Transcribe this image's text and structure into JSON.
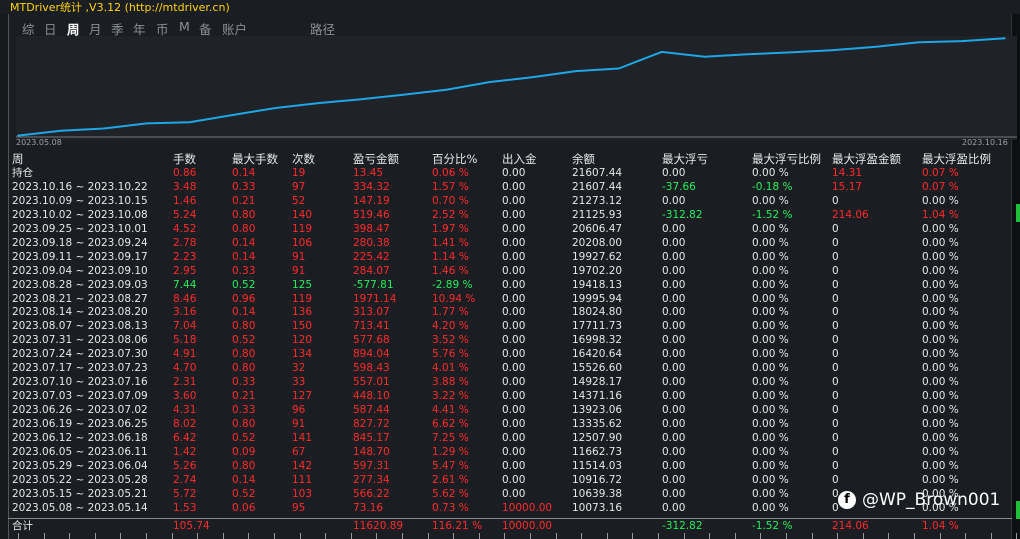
{
  "window": {
    "title": "MTDriver统计 ,V3.12 (http://mtdriver.cn)"
  },
  "tabs": [
    {
      "label": "综",
      "active": false
    },
    {
      "label": "日",
      "active": false
    },
    {
      "label": "周",
      "active": true
    },
    {
      "label": "月",
      "active": false
    },
    {
      "label": "季",
      "active": false
    },
    {
      "label": "年",
      "active": false
    },
    {
      "label": "币",
      "active": false
    },
    {
      "label": "M",
      "active": false
    },
    {
      "label": "备",
      "active": false
    },
    {
      "label": "账户",
      "active": false
    }
  ],
  "path_label": "路径",
  "chart_data": {
    "type": "line",
    "x_start_label": "2023.05.08",
    "x_end_label": "2023.10.16",
    "x": [
      "2023.05.08",
      "2023.05.15",
      "2023.05.22",
      "2023.05.29",
      "2023.06.05",
      "2023.06.12",
      "2023.06.19",
      "2023.06.26",
      "2023.07.03",
      "2023.07.10",
      "2023.07.17",
      "2023.07.24",
      "2023.07.31",
      "2023.08.07",
      "2023.08.14",
      "2023.08.21",
      "2023.08.28",
      "2023.09.04",
      "2023.09.11",
      "2023.09.18",
      "2023.09.25",
      "2023.10.02",
      "2023.10.09",
      "2023.10.16"
    ],
    "values": [
      10073.16,
      10639.38,
      10916.72,
      11514.03,
      11662.73,
      12507.9,
      13335.62,
      13923.06,
      14371.16,
      14928.17,
      15526.6,
      16420.64,
      16998.32,
      17711.73,
      18024.8,
      19995.94,
      19418.13,
      19702.2,
      19927.62,
      20208.0,
      20606.47,
      21125.93,
      21273.12,
      21607.44
    ],
    "line_color": "#1ea7e6"
  },
  "table": {
    "headers": [
      "周",
      "手数",
      "最大手数",
      "次数",
      "盈亏金额",
      "百分比%",
      "出入金",
      "余额",
      "最大浮亏",
      "最大浮亏比例",
      "最大浮盈金额",
      "最大浮盈比例"
    ],
    "rows": [
      {
        "cells": [
          "持仓",
          "0.86",
          "0.14",
          "19",
          "13.45",
          "0.06 %",
          "0.00",
          "21607.44",
          "0.00",
          "0.00 %",
          "14.31",
          "0.07 %"
        ],
        "colors": [
          "w",
          "r",
          "r",
          "r",
          "r",
          "r",
          "w",
          "w",
          "w",
          "w",
          "r",
          "r"
        ]
      },
      {
        "cells": [
          "2023.10.16 ~ 2023.10.22",
          "3.48",
          "0.33",
          "97",
          "334.32",
          "1.57 %",
          "0.00",
          "21607.44",
          "-37.66",
          "-0.18 %",
          "15.17",
          "0.07 %"
        ],
        "colors": [
          "w",
          "r",
          "r",
          "r",
          "r",
          "r",
          "w",
          "w",
          "g",
          "g",
          "r",
          "r"
        ]
      },
      {
        "cells": [
          "2023.10.09 ~ 2023.10.15",
          "1.46",
          "0.21",
          "52",
          "147.19",
          "0.70 %",
          "0.00",
          "21273.12",
          "0.00",
          "0.00 %",
          "0",
          "0.00 %"
        ],
        "colors": [
          "w",
          "r",
          "r",
          "r",
          "r",
          "r",
          "w",
          "w",
          "w",
          "w",
          "w",
          "w"
        ]
      },
      {
        "cells": [
          "2023.10.02 ~ 2023.10.08",
          "5.24",
          "0.80",
          "140",
          "519.46",
          "2.52 %",
          "0.00",
          "21125.93",
          "-312.82",
          "-1.52 %",
          "214.06",
          "1.04 %"
        ],
        "colors": [
          "w",
          "r",
          "r",
          "r",
          "r",
          "r",
          "w",
          "w",
          "g",
          "g",
          "r",
          "r"
        ]
      },
      {
        "cells": [
          "2023.09.25 ~ 2023.10.01",
          "4.52",
          "0.80",
          "119",
          "398.47",
          "1.97 %",
          "0.00",
          "20606.47",
          "0.00",
          "0.00 %",
          "0",
          "0.00 %"
        ],
        "colors": [
          "w",
          "r",
          "r",
          "r",
          "r",
          "r",
          "w",
          "w",
          "w",
          "w",
          "w",
          "w"
        ]
      },
      {
        "cells": [
          "2023.09.18 ~ 2023.09.24",
          "2.78",
          "0.14",
          "106",
          "280.38",
          "1.41 %",
          "0.00",
          "20208.00",
          "0.00",
          "0.00 %",
          "0",
          "0.00 %"
        ],
        "colors": [
          "w",
          "r",
          "r",
          "r",
          "r",
          "r",
          "w",
          "w",
          "w",
          "w",
          "w",
          "w"
        ]
      },
      {
        "cells": [
          "2023.09.11 ~ 2023.09.17",
          "2.23",
          "0.14",
          "91",
          "225.42",
          "1.14 %",
          "0.00",
          "19927.62",
          "0.00",
          "0.00 %",
          "0",
          "0.00 %"
        ],
        "colors": [
          "w",
          "r",
          "r",
          "r",
          "r",
          "r",
          "w",
          "w",
          "w",
          "w",
          "w",
          "w"
        ]
      },
      {
        "cells": [
          "2023.09.04 ~ 2023.09.10",
          "2.95",
          "0.33",
          "91",
          "284.07",
          "1.46 %",
          "0.00",
          "19702.20",
          "0.00",
          "0.00 %",
          "0",
          "0.00 %"
        ],
        "colors": [
          "w",
          "r",
          "r",
          "r",
          "r",
          "r",
          "w",
          "w",
          "w",
          "w",
          "w",
          "w"
        ]
      },
      {
        "cells": [
          "2023.08.28 ~ 2023.09.03",
          "7.44",
          "0.52",
          "125",
          "-577.81",
          "-2.89 %",
          "0.00",
          "19418.13",
          "0.00",
          "0.00 %",
          "0",
          "0.00 %"
        ],
        "colors": [
          "w",
          "g",
          "g",
          "g",
          "g",
          "g",
          "w",
          "w",
          "w",
          "w",
          "w",
          "w"
        ]
      },
      {
        "cells": [
          "2023.08.21 ~ 2023.08.27",
          "8.46",
          "0.96",
          "119",
          "1971.14",
          "10.94 %",
          "0.00",
          "19995.94",
          "0.00",
          "0.00 %",
          "0",
          "0.00 %"
        ],
        "colors": [
          "w",
          "r",
          "r",
          "r",
          "r",
          "r",
          "w",
          "w",
          "w",
          "w",
          "w",
          "w"
        ]
      },
      {
        "cells": [
          "2023.08.14 ~ 2023.08.20",
          "3.16",
          "0.14",
          "136",
          "313.07",
          "1.77 %",
          "0.00",
          "18024.80",
          "0.00",
          "0.00 %",
          "0",
          "0.00 %"
        ],
        "colors": [
          "w",
          "r",
          "r",
          "r",
          "r",
          "r",
          "w",
          "w",
          "w",
          "w",
          "w",
          "w"
        ]
      },
      {
        "cells": [
          "2023.08.07 ~ 2023.08.13",
          "7.04",
          "0.80",
          "150",
          "713.41",
          "4.20 %",
          "0.00",
          "17711.73",
          "0.00",
          "0.00 %",
          "0",
          "0.00 %"
        ],
        "colors": [
          "w",
          "r",
          "r",
          "r",
          "r",
          "r",
          "w",
          "w",
          "w",
          "w",
          "w",
          "w"
        ]
      },
      {
        "cells": [
          "2023.07.31 ~ 2023.08.06",
          "5.18",
          "0.52",
          "120",
          "577.68",
          "3.52 %",
          "0.00",
          "16998.32",
          "0.00",
          "0.00 %",
          "0",
          "0.00 %"
        ],
        "colors": [
          "w",
          "r",
          "r",
          "r",
          "r",
          "r",
          "w",
          "w",
          "w",
          "w",
          "w",
          "w"
        ]
      },
      {
        "cells": [
          "2023.07.24 ~ 2023.07.30",
          "4.91",
          "0.80",
          "134",
          "894.04",
          "5.76 %",
          "0.00",
          "16420.64",
          "0.00",
          "0.00 %",
          "0",
          "0.00 %"
        ],
        "colors": [
          "w",
          "r",
          "r",
          "r",
          "r",
          "r",
          "w",
          "w",
          "w",
          "w",
          "w",
          "w"
        ]
      },
      {
        "cells": [
          "2023.07.17 ~ 2023.07.23",
          "4.70",
          "0.80",
          "32",
          "598.43",
          "4.01 %",
          "0.00",
          "15526.60",
          "0.00",
          "0.00 %",
          "0",
          "0.00 %"
        ],
        "colors": [
          "w",
          "r",
          "r",
          "r",
          "r",
          "r",
          "w",
          "w",
          "w",
          "w",
          "w",
          "w"
        ]
      },
      {
        "cells": [
          "2023.07.10 ~ 2023.07.16",
          "2.31",
          "0.33",
          "33",
          "557.01",
          "3.88 %",
          "0.00",
          "14928.17",
          "0.00",
          "0.00 %",
          "0",
          "0.00 %"
        ],
        "colors": [
          "w",
          "r",
          "r",
          "r",
          "r",
          "r",
          "w",
          "w",
          "w",
          "w",
          "w",
          "w"
        ]
      },
      {
        "cells": [
          "2023.07.03 ~ 2023.07.09",
          "3.60",
          "0.21",
          "127",
          "448.10",
          "3.22 %",
          "0.00",
          "14371.16",
          "0.00",
          "0.00 %",
          "0",
          "0.00 %"
        ],
        "colors": [
          "w",
          "r",
          "r",
          "r",
          "r",
          "r",
          "w",
          "w",
          "w",
          "w",
          "w",
          "w"
        ]
      },
      {
        "cells": [
          "2023.06.26 ~ 2023.07.02",
          "4.31",
          "0.33",
          "96",
          "587.44",
          "4.41 %",
          "0.00",
          "13923.06",
          "0.00",
          "0.00 %",
          "0",
          "0.00 %"
        ],
        "colors": [
          "w",
          "r",
          "r",
          "r",
          "r",
          "r",
          "w",
          "w",
          "w",
          "w",
          "w",
          "w"
        ]
      },
      {
        "cells": [
          "2023.06.19 ~ 2023.06.25",
          "8.02",
          "0.80",
          "91",
          "827.72",
          "6.62 %",
          "0.00",
          "13335.62",
          "0.00",
          "0.00 %",
          "0",
          "0.00 %"
        ],
        "colors": [
          "w",
          "r",
          "r",
          "r",
          "r",
          "r",
          "w",
          "w",
          "w",
          "w",
          "w",
          "w"
        ]
      },
      {
        "cells": [
          "2023.06.12 ~ 2023.06.18",
          "6.42",
          "0.52",
          "141",
          "845.17",
          "7.25 %",
          "0.00",
          "12507.90",
          "0.00",
          "0.00 %",
          "0",
          "0.00 %"
        ],
        "colors": [
          "w",
          "r",
          "r",
          "r",
          "r",
          "r",
          "w",
          "w",
          "w",
          "w",
          "w",
          "w"
        ]
      },
      {
        "cells": [
          "2023.06.05 ~ 2023.06.11",
          "1.42",
          "0.09",
          "67",
          "148.70",
          "1.29 %",
          "0.00",
          "11662.73",
          "0.00",
          "0.00 %",
          "0",
          "0.00 %"
        ],
        "colors": [
          "w",
          "r",
          "r",
          "r",
          "r",
          "r",
          "w",
          "w",
          "w",
          "w",
          "w",
          "w"
        ]
      },
      {
        "cells": [
          "2023.05.29 ~ 2023.06.04",
          "5.26",
          "0.80",
          "142",
          "597.31",
          "5.47 %",
          "0.00",
          "11514.03",
          "0.00",
          "0.00 %",
          "0",
          "0.00 %"
        ],
        "colors": [
          "w",
          "r",
          "r",
          "r",
          "r",
          "r",
          "w",
          "w",
          "w",
          "w",
          "w",
          "w"
        ]
      },
      {
        "cells": [
          "2023.05.22 ~ 2023.05.28",
          "2.74",
          "0.14",
          "111",
          "277.34",
          "2.61 %",
          "0.00",
          "10916.72",
          "0.00",
          "0.00 %",
          "0",
          "0.00 %"
        ],
        "colors": [
          "w",
          "r",
          "r",
          "r",
          "r",
          "r",
          "w",
          "w",
          "w",
          "w",
          "w",
          "w"
        ]
      },
      {
        "cells": [
          "2023.05.15 ~ 2023.05.21",
          "5.72",
          "0.52",
          "103",
          "566.22",
          "5.62 %",
          "0.00",
          "10639.38",
          "0.00",
          "0.00 %",
          "0",
          "0.00 %"
        ],
        "colors": [
          "w",
          "r",
          "r",
          "r",
          "r",
          "r",
          "w",
          "w",
          "w",
          "w",
          "w",
          "w"
        ]
      },
      {
        "cells": [
          "2023.05.08 ~ 2023.05.14",
          "1.53",
          "0.06",
          "95",
          "73.16",
          "0.73 %",
          "10000.00",
          "10073.16",
          "0.00",
          "0.00 %",
          "0",
          "0.00 %"
        ],
        "colors": [
          "w",
          "r",
          "r",
          "r",
          "r",
          "r",
          "r",
          "w",
          "w",
          "w",
          "w",
          "w"
        ]
      }
    ],
    "total": {
      "cells": [
        "合计",
        "105.74",
        "",
        "",
        "11620.89",
        "116.21 %",
        "10000.00",
        "",
        "-312.82",
        "-1.52 %",
        "214.06",
        "1.04 %"
      ],
      "colors": [
        "w",
        "r",
        "w",
        "w",
        "r",
        "r",
        "r",
        "w",
        "g",
        "g",
        "r",
        "r"
      ]
    }
  },
  "watermark": {
    "icon": "facebook-icon",
    "text": "@WP_Brown001"
  },
  "colors": {
    "red": "#ff2b2b",
    "green": "#21f05a",
    "white": "#e6e6e6",
    "title_yellow": "#ffd400"
  }
}
